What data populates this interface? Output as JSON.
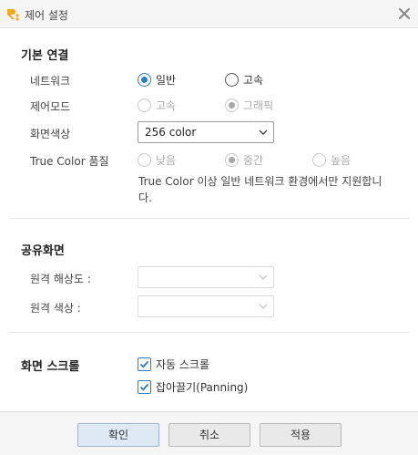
{
  "window": {
    "title": "제어 설정",
    "app_icon": "rc-logo-icon",
    "close_icon": "close-icon"
  },
  "basic": {
    "section_title": "기본 연결",
    "network_label": "네트워크",
    "network_options": [
      "일반",
      "고속"
    ],
    "network_selected": "일반",
    "control_mode_label": "제어모드",
    "control_mode_options": [
      "고속",
      "그래픽"
    ],
    "control_mode_selected": "그래픽",
    "control_mode_disabled": true,
    "color_label": "화면색상",
    "color_value": "256 color",
    "truecolor_label": "True  Color 품질",
    "truecolor_options": [
      "낮음",
      "중간",
      "높음"
    ],
    "truecolor_selected": "중간",
    "truecolor_disabled": true,
    "truecolor_note": "True  Color 이상 일반 네트워크 환경에서만 지원합니다."
  },
  "shared": {
    "section_title": "공유화면",
    "resolution_label": "원격 해상도 :",
    "resolution_value": "",
    "color_label": "원격 색상 :",
    "color_value": ""
  },
  "scroll": {
    "section_title": "화면 스크롤",
    "auto_scroll_label": "자동 스크롤",
    "auto_scroll_checked": true,
    "panning_label": "잡아끌기(Panning)",
    "panning_checked": true
  },
  "footer": {
    "ok_label": "확인",
    "cancel_label": "취소",
    "apply_label": "적용"
  },
  "colors": {
    "accent": "#2a7fc2",
    "logo": "#f5a81c"
  }
}
